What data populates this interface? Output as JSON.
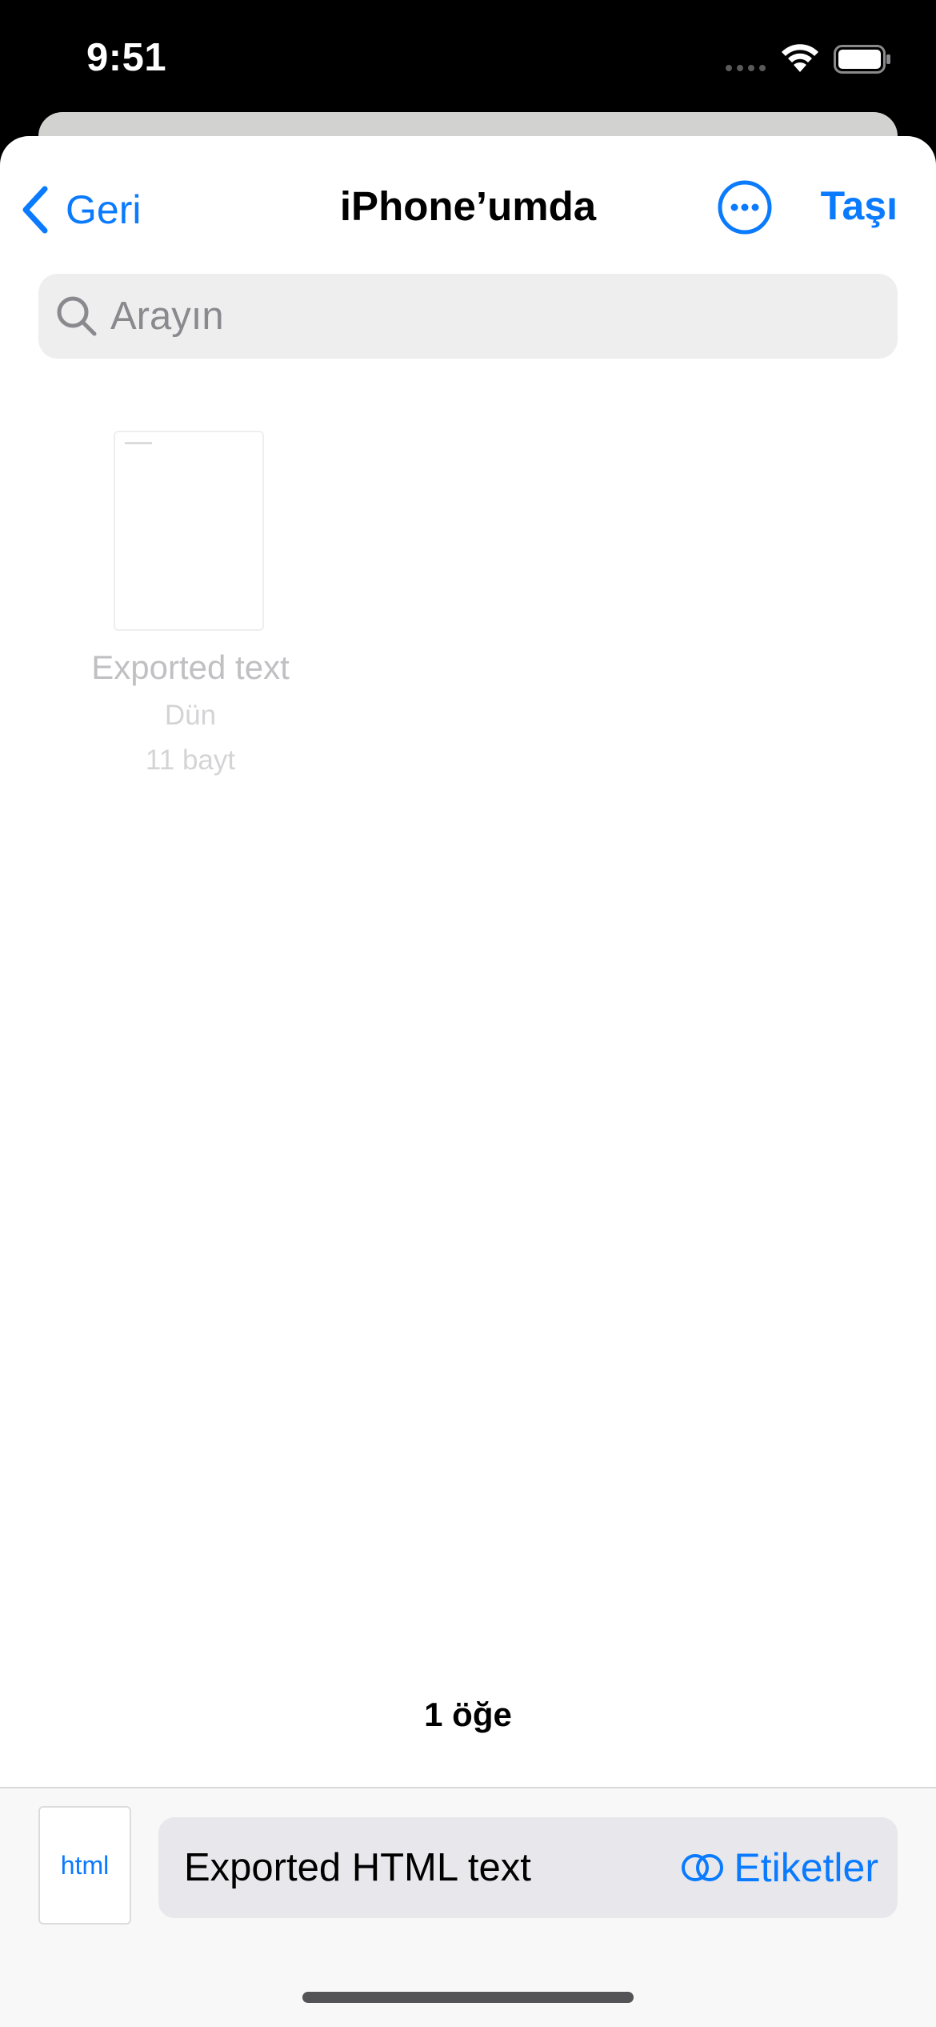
{
  "status_bar": {
    "time": "9:51"
  },
  "nav": {
    "back_label": "Geri",
    "title": "iPhone’umda",
    "move_label": "Taşı"
  },
  "search": {
    "placeholder": "Arayın",
    "value": ""
  },
  "files": [
    {
      "name": "Exported text",
      "date": "Dün",
      "size": "11 bayt"
    }
  ],
  "footer": {
    "item_count": "1 öğe"
  },
  "save_panel": {
    "file_type_label": "html",
    "filename_value": "Exported HTML text",
    "tags_label": "Etiketler"
  },
  "colors": {
    "accent": "#0a7aff",
    "background": "#ffffff",
    "status_bar_bg": "#000000"
  },
  "icons": {
    "back": "chevron-left-icon",
    "more": "ellipsis-circle-icon",
    "search": "magnifier-icon",
    "tags": "tag-circles-icon",
    "wifi": "wifi-icon",
    "battery": "battery-icon",
    "signal": "cellular-signal-icon"
  }
}
